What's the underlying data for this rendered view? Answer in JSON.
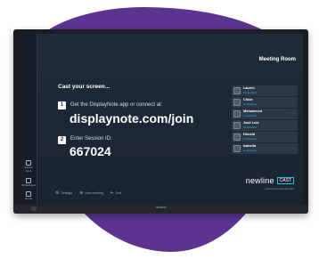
{
  "meeting_room": "Meeting Room",
  "cast": {
    "heading": "Cast your screen...",
    "step1": {
      "number": "1",
      "text": "Get the DisplayNote app or connect at:",
      "value": "displaynote.com/join"
    },
    "step2": {
      "number": "2",
      "text": "Enter Session ID:",
      "value": "667024"
    }
  },
  "participants": [
    {
      "name": "Lauren",
      "status": "Connected"
    },
    {
      "name": "Chloe",
      "status": "Connected"
    },
    {
      "name": "Mohammed",
      "status": "Connected"
    },
    {
      "name": "José Luis",
      "status": "Connected"
    },
    {
      "name": "Hiroshi",
      "status": "Connected"
    },
    {
      "name": "Isabella",
      "status": "Connected"
    }
  ],
  "participant_menu_icon": "⋯",
  "bottom_actions": [
    {
      "icon": "⚙",
      "label": "Settings",
      "icon_name": "gear-icon"
    },
    {
      "icon": "⊕",
      "label": "New meeting",
      "icon_name": "plus-circle-icon"
    },
    {
      "icon": "⇤",
      "label": "Exit",
      "icon_name": "exit-icon"
    }
  ],
  "sidebar_items": [
    {
      "label": "Source Input",
      "icon_name": "input-icon"
    },
    {
      "label": "Whiteboard",
      "icon_name": "whiteboard-icon"
    },
    {
      "label": "Home",
      "icon_name": "home-icon"
    }
  ],
  "brand": {
    "name": "newline",
    "sub": "CAST",
    "powered": "powered by DisplayNote"
  },
  "bezel_brand": "newline",
  "colors": {
    "blob": "#5b3490",
    "screen_bg": "#1f2b3a",
    "accent": "#25c1d8",
    "row_bg": "#2c3848"
  }
}
